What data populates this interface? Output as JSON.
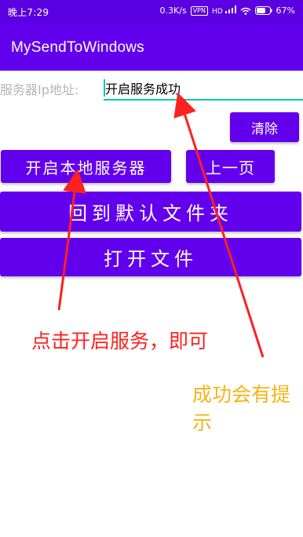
{
  "status_bar": {
    "time": "晚上7:29",
    "speed": "0.3K/s",
    "vpn": "VPN",
    "network": "HD",
    "battery": "67%"
  },
  "app_bar": {
    "title": "MySendToWindows"
  },
  "form": {
    "ip_label": "服务器Ip地址:",
    "ip_value": "开启服务成功"
  },
  "buttons": {
    "clear": "清除",
    "start_server": "开启本地服务器",
    "prev_page": "上一页",
    "default_folder": "回到默认文件夹",
    "open_file": "打开文件"
  },
  "annotations": {
    "red_text": "点击开启服务，即可",
    "yellow_text": "成功会有提示",
    "red_color": "#ff2020",
    "yellow_color": "#f2b418"
  },
  "colors": {
    "primary": "#6200ee",
    "primary_dark": "#5b00e0",
    "accent": "#03c5b1"
  }
}
